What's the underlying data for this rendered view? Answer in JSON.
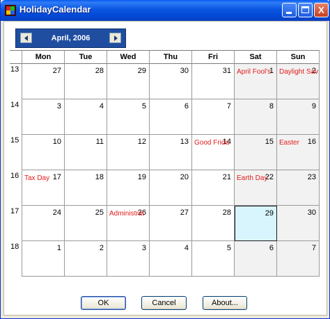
{
  "window": {
    "title": "HolidayCalendar",
    "min_glyph": "",
    "max_glyph": "",
    "close_glyph": "X"
  },
  "nav": {
    "month_label": "April, 2006"
  },
  "weekdays": [
    "Mon",
    "Tue",
    "Wed",
    "Thu",
    "Fri",
    "Sat",
    "Sun"
  ],
  "weeks": [
    {
      "number": "13",
      "days": [
        {
          "day": "27",
          "holiday": ""
        },
        {
          "day": "28",
          "holiday": ""
        },
        {
          "day": "29",
          "holiday": ""
        },
        {
          "day": "30",
          "holiday": ""
        },
        {
          "day": "31",
          "holiday": ""
        },
        {
          "day": "1",
          "holiday": "April Fool's"
        },
        {
          "day": "2",
          "holiday": "Daylight Sav"
        }
      ]
    },
    {
      "number": "14",
      "days": [
        {
          "day": "3",
          "holiday": ""
        },
        {
          "day": "4",
          "holiday": ""
        },
        {
          "day": "5",
          "holiday": ""
        },
        {
          "day": "6",
          "holiday": ""
        },
        {
          "day": "7",
          "holiday": ""
        },
        {
          "day": "8",
          "holiday": ""
        },
        {
          "day": "9",
          "holiday": ""
        }
      ]
    },
    {
      "number": "15",
      "days": [
        {
          "day": "10",
          "holiday": ""
        },
        {
          "day": "11",
          "holiday": ""
        },
        {
          "day": "12",
          "holiday": ""
        },
        {
          "day": "13",
          "holiday": ""
        },
        {
          "day": "14",
          "holiday": "Good Frida"
        },
        {
          "day": "15",
          "holiday": ""
        },
        {
          "day": "16",
          "holiday": "Easter"
        }
      ]
    },
    {
      "number": "16",
      "days": [
        {
          "day": "17",
          "holiday": "Tax Day"
        },
        {
          "day": "18",
          "holiday": ""
        },
        {
          "day": "19",
          "holiday": ""
        },
        {
          "day": "20",
          "holiday": ""
        },
        {
          "day": "21",
          "holiday": ""
        },
        {
          "day": "22",
          "holiday": "Earth Day"
        },
        {
          "day": "23",
          "holiday": ""
        }
      ]
    },
    {
      "number": "17",
      "days": [
        {
          "day": "24",
          "holiday": ""
        },
        {
          "day": "25",
          "holiday": ""
        },
        {
          "day": "26",
          "holiday": "Administrat"
        },
        {
          "day": "27",
          "holiday": ""
        },
        {
          "day": "28",
          "holiday": ""
        },
        {
          "day": "29",
          "holiday": "",
          "today": true
        },
        {
          "day": "30",
          "holiday": ""
        }
      ]
    },
    {
      "number": "18",
      "days": [
        {
          "day": "1",
          "holiday": ""
        },
        {
          "day": "2",
          "holiday": ""
        },
        {
          "day": "3",
          "holiday": ""
        },
        {
          "day": "4",
          "holiday": ""
        },
        {
          "day": "5",
          "holiday": ""
        },
        {
          "day": "6",
          "holiday": ""
        },
        {
          "day": "7",
          "holiday": ""
        }
      ]
    }
  ],
  "buttons": {
    "ok": "OK",
    "cancel": "Cancel",
    "about": "About..."
  },
  "colors": {
    "holiday_text": "#e21b1b",
    "today_bg": "#d8f4fd",
    "nav_bg": "#1f4ea1"
  }
}
